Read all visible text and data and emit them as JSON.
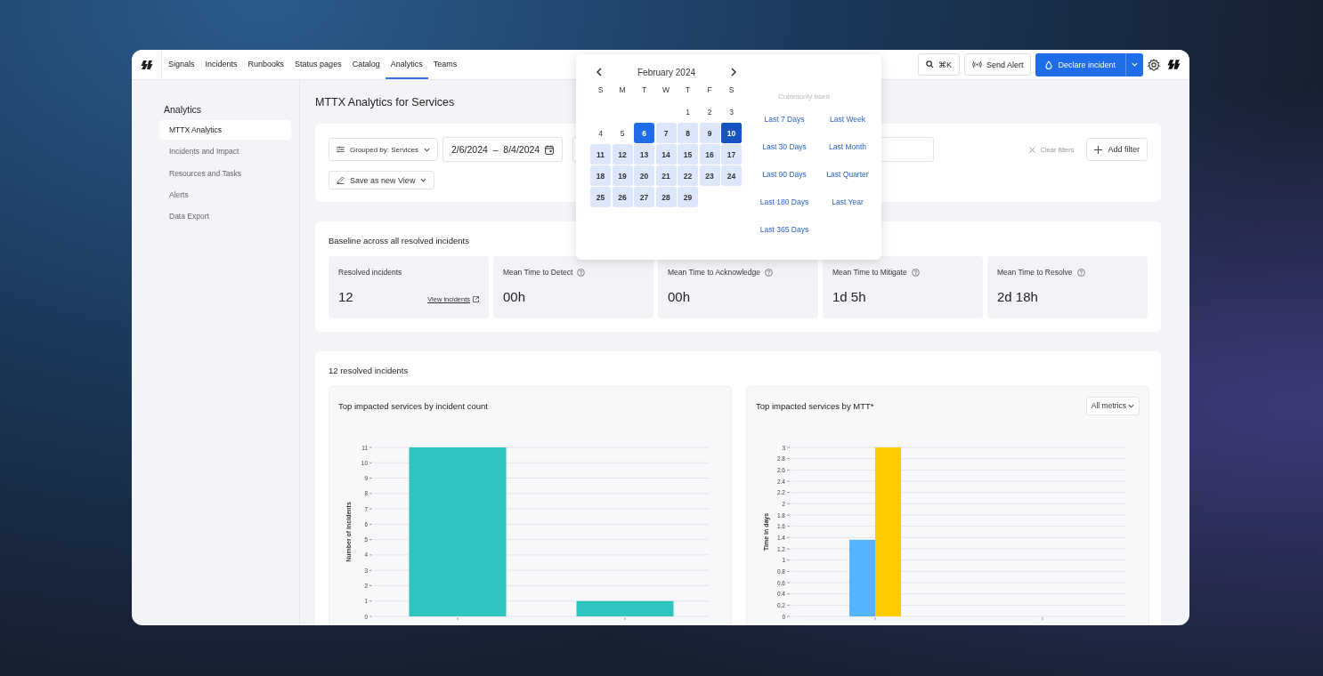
{
  "nav": {
    "tabs": [
      {
        "label": "Signals",
        "selected": false
      },
      {
        "label": "Incidents",
        "selected": false
      },
      {
        "label": "Runbooks",
        "selected": false
      },
      {
        "label": "Status pages",
        "selected": false
      },
      {
        "label": "Catalog",
        "selected": false
      },
      {
        "label": "Analytics",
        "selected": true
      },
      {
        "label": "Teams",
        "selected": false
      }
    ],
    "search_shortcut": "⌘K",
    "send_alert": "Send Alert",
    "declare": "Declare incident"
  },
  "sidebar": {
    "heading": "Analytics",
    "items": [
      {
        "label": "MTTX Analytics",
        "selected": true
      },
      {
        "label": "Incidents and Impact",
        "selected": false
      },
      {
        "label": "Resources and Tasks",
        "selected": false
      },
      {
        "label": "Alerts",
        "selected": false
      },
      {
        "label": "Data Export",
        "selected": false
      }
    ]
  },
  "page_title": "MTTX Analytics for Services",
  "filters": {
    "group_by": "Grouped by: Services",
    "date_range": "2/6/2024  –  8/4/2024",
    "clear": "Clear filters",
    "add": "Add filter",
    "save_view": "Save as new View"
  },
  "calendar": {
    "month": "February 2024",
    "weekdays": [
      "S",
      "M",
      "T",
      "W",
      "T",
      "F",
      "S"
    ],
    "presets_heading": "Commonly used",
    "weeks": [
      {
        "days": [
          {
            "day": "1",
            "in_range": false,
            "selected": false,
            "focused": false
          },
          {
            "day": "2",
            "in_range": false,
            "selected": false,
            "focused": false
          },
          {
            "day": "3",
            "in_range": false,
            "selected": false,
            "focused": false
          }
        ]
      },
      {
        "days": [
          {
            "day": "4",
            "in_range": false,
            "selected": false,
            "focused": false
          },
          {
            "day": "5",
            "in_range": false,
            "selected": false,
            "focused": false
          },
          {
            "day": "6",
            "in_range": true,
            "selected": true,
            "focused": false
          },
          {
            "day": "7",
            "in_range": true,
            "selected": false,
            "focused": false
          },
          {
            "day": "8",
            "in_range": true,
            "selected": false,
            "focused": false
          },
          {
            "day": "9",
            "in_range": true,
            "selected": false,
            "focused": false
          },
          {
            "day": "10",
            "in_range": true,
            "selected": true,
            "focused": true
          }
        ]
      },
      {
        "days": [
          {
            "day": "11",
            "in_range": true,
            "selected": false,
            "focused": false
          },
          {
            "day": "12",
            "in_range": true,
            "selected": false,
            "focused": false
          },
          {
            "day": "13",
            "in_range": true,
            "selected": false,
            "focused": false
          },
          {
            "day": "14",
            "in_range": true,
            "selected": false,
            "focused": false
          },
          {
            "day": "15",
            "in_range": true,
            "selected": false,
            "focused": false
          },
          {
            "day": "16",
            "in_range": true,
            "selected": false,
            "focused": false
          },
          {
            "day": "17",
            "in_range": true,
            "selected": false,
            "focused": false
          }
        ]
      },
      {
        "days": [
          {
            "day": "18",
            "in_range": true,
            "selected": false,
            "focused": false
          },
          {
            "day": "19",
            "in_range": true,
            "selected": false,
            "focused": false
          },
          {
            "day": "20",
            "in_range": true,
            "selected": false,
            "focused": false
          },
          {
            "day": "21",
            "in_range": true,
            "selected": false,
            "focused": false
          },
          {
            "day": "22",
            "in_range": true,
            "selected": false,
            "focused": false
          },
          {
            "day": "23",
            "in_range": true,
            "selected": false,
            "focused": false
          },
          {
            "day": "24",
            "in_range": true,
            "selected": false,
            "focused": false
          }
        ]
      },
      {
        "days": [
          {
            "day": "25",
            "in_range": true,
            "selected": false,
            "focused": false
          },
          {
            "day": "26",
            "in_range": true,
            "selected": false,
            "focused": false
          },
          {
            "day": "27",
            "in_range": true,
            "selected": false,
            "focused": false
          },
          {
            "day": "28",
            "in_range": true,
            "selected": false,
            "focused": false
          },
          {
            "day": "29",
            "in_range": true,
            "selected": false,
            "focused": false
          }
        ]
      }
    ],
    "presets": [
      "Last 7 Days",
      "Last Week",
      "Last 30 Days",
      "Last Month",
      "Last 90 Days",
      "Last Quarter",
      "Last 180 Days",
      "Last Year",
      "Last 365 Days"
    ]
  },
  "baseline": {
    "title": "Baseline across all resolved incidents",
    "metrics": [
      {
        "label": "Resolved incidents",
        "value": "12",
        "info": false,
        "link": "View incidents"
      },
      {
        "label": "Mean Time to Detect",
        "value": "00h",
        "info": true
      },
      {
        "label": "Mean Time to Acknowledge",
        "value": "00h",
        "info": true
      },
      {
        "label": "Mean Time to Mitigate",
        "value": "1d 5h",
        "info": true
      },
      {
        "label": "Mean Time to Resolve",
        "value": "2d 18h",
        "info": true
      }
    ]
  },
  "resolved": {
    "title": "12 resolved incidents",
    "panels": [
      {
        "title": "Top impacted services by incident count",
        "chart_data": {
          "type": "bar",
          "grid": true,
          "ylabel": "Number of incidents",
          "ylim": [
            0,
            11
          ],
          "yticks": [
            0,
            1,
            2,
            3,
            4,
            5,
            6,
            7,
            8,
            9,
            10,
            11
          ],
          "series": [
            {
              "color": "#2ec4bf",
              "values": [
                11,
                1
              ]
            }
          ]
        }
      },
      {
        "title": "Top impacted services by MTT*",
        "dropdown": "All metrics",
        "chart_data": {
          "type": "bar",
          "grid": true,
          "ylabel": "Time in days",
          "ylim": [
            0,
            3
          ],
          "yticks": [
            0,
            {
              "value": 0.2,
              "label": "0.2"
            },
            {
              "value": 0.4,
              "label": "0.4"
            },
            {
              "value": 0.6,
              "label": "0.6"
            },
            {
              "value": 0.8,
              "label": "0.8"
            },
            1,
            {
              "value": 1.2,
              "label": "1.2"
            },
            {
              "value": 1.4,
              "label": "1.4"
            },
            {
              "value": 1.6,
              "label": "1.6"
            },
            {
              "value": 1.8,
              "label": "1.8"
            },
            2,
            {
              "value": 2.2,
              "label": "2.2"
            },
            {
              "value": 2.4,
              "label": "2.4"
            },
            {
              "value": 2.6,
              "label": "2.6"
            },
            {
              "value": 2.8,
              "label": "2.8"
            },
            3
          ],
          "series": [
            {
              "color": "#55b4ff",
              "values": [
                1.36,
                null
              ]
            },
            {
              "color": "#ffcb00",
              "values": [
                3,
                null
              ]
            }
          ]
        }
      }
    ]
  }
}
